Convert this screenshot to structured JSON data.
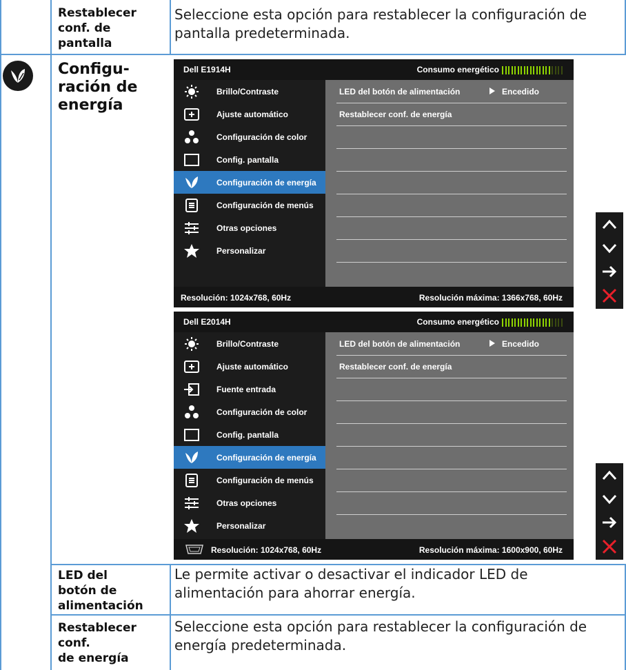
{
  "rows": {
    "reset_display": {
      "label": "Restablecer conf. de pantalla",
      "description": "Seleccione esta opción para restablecer la configuración de pantalla predeterminada."
    },
    "power_settings": {
      "label": "Configu-ración de energía",
      "label_lines": [
        "Configu-",
        "ración de",
        "energía"
      ],
      "icon": "leaf-power-icon"
    },
    "power_led": {
      "label": "LED del botón de alimentación",
      "label_lines": [
        "LED del",
        "botón de",
        "alimentación"
      ],
      "description": "Le permite activar o desactivar el indicador LED de alimentación para ahorrar energía."
    },
    "reset_power": {
      "label": "Restablecer conf. de energía",
      "label_lines": [
        "Restablecer",
        "conf.",
        "de energía"
      ],
      "description": "Seleccione esta opción para restablecer la configuración de energía predeterminada."
    }
  },
  "reset_display_lines": [
    "Restablecer",
    "conf. de",
    "pantalla"
  ],
  "osd1": {
    "model": "Dell E1914H",
    "power_label": "Consumo energético",
    "power_level": 0.78,
    "menu": [
      {
        "label": "Brillo/Contraste",
        "icon": "brightness-icon"
      },
      {
        "label": "Ajuste  automático",
        "icon": "auto-adjust-icon"
      },
      {
        "label": "Configuración de color",
        "icon": "color-dots-icon"
      },
      {
        "label": "Config. pantalla",
        "icon": "display-icon"
      },
      {
        "label": "Configuración de energía",
        "icon": "leaf-power-icon",
        "selected": true
      },
      {
        "label": "Configuración de menús",
        "icon": "menu-icon"
      },
      {
        "label": "Otras opciones",
        "icon": "sliders-icon"
      },
      {
        "label": "Personalizar",
        "icon": "star-icon"
      }
    ],
    "submenu": [
      {
        "label": "LED del botón de alimentación",
        "value": "Encedido"
      },
      {
        "label": "Restablecer conf. de energía",
        "value": ""
      }
    ],
    "resolution": "Resolución: 1024x768, 60Hz",
    "max_resolution": "Resolución máxima: 1366x768, 60Hz"
  },
  "osd2": {
    "model": "Dell E2014H",
    "power_label": "Consumo energético",
    "power_level": 0.78,
    "menu": [
      {
        "label": "Brillo/Contraste",
        "icon": "brightness-icon"
      },
      {
        "label": "Ajuste  automático",
        "icon": "auto-adjust-icon"
      },
      {
        "label": "Fuente entrada",
        "icon": "input-source-icon"
      },
      {
        "label": "Configuración de color",
        "icon": "color-dots-icon"
      },
      {
        "label": "Config. pantalla",
        "icon": "display-icon"
      },
      {
        "label": "Configuración de energía",
        "icon": "leaf-power-icon",
        "selected": true
      },
      {
        "label": "Configuración de menús",
        "icon": "menu-icon"
      },
      {
        "label": "Otras opciones",
        "icon": "sliders-icon"
      },
      {
        "label": "Personalizar",
        "icon": "star-icon"
      }
    ],
    "submenu": [
      {
        "label": "LED del botón de alimentación",
        "value": "Encedido"
      },
      {
        "label": "Restablecer conf. de energía",
        "value": ""
      }
    ],
    "resolution": "Resolución: 1024x768, 60Hz",
    "max_resolution": "Resolución máxima: 1600x900, 60Hz",
    "connector_icon": "vga-connector-icon"
  },
  "nav_buttons": [
    "up-arrow-icon",
    "down-arrow-icon",
    "right-arrow-icon",
    "close-icon"
  ],
  "colors": {
    "table_border": "#5b9bd5",
    "osd_selected": "#2e79bf",
    "osd_panel": "#6e6e6e",
    "power_meter": "#8fd400",
    "close_x": "#e8202a"
  }
}
